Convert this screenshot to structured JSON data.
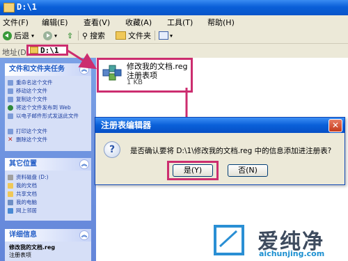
{
  "window": {
    "title": "D:\\1"
  },
  "menu": [
    "文件(F)",
    "编辑(E)",
    "查看(V)",
    "收藏(A)",
    "工具(T)",
    "帮助(H)"
  ],
  "toolbar": {
    "back_label": "后退",
    "search_label": "搜索",
    "folders_label": "文件夹"
  },
  "address": {
    "label": "地址(D)",
    "value": "D:\\1"
  },
  "left_pane": {
    "tasks": {
      "title": "文件和文件夹任务",
      "items": [
        "重命名这个文件",
        "移动这个文件",
        "复制这个文件",
        "将这个文件发布到 Web",
        "以电子邮件形式发送此文件",
        "打印这个文件",
        "删除这个文件"
      ]
    },
    "other_places": {
      "title": "其它位置",
      "items": [
        "资料磁盘 (D:)",
        "我的文档",
        "共享文档",
        "我的电脑",
        "网上邻居"
      ]
    },
    "details": {
      "title": "详细信息",
      "name": "修改我的文档.reg",
      "type": "注册表项"
    }
  },
  "file": {
    "name": "修改我的文档.reg",
    "type": "注册表项",
    "size": "1 KB"
  },
  "dialog": {
    "title": "注册表编辑器",
    "message": "是否确认要将 D:\\1\\修改我的文档.reg 中的信息添加进注册表?",
    "yes_label": "是(Y)",
    "no_label": "否(N)"
  },
  "watermark": {
    "brand": "爱纯净",
    "url": "aichunjing.com"
  },
  "colors": {
    "highlight": "#cc2d6f",
    "titlebar": "#0a5fd8",
    "panel": "#d6dff7"
  }
}
